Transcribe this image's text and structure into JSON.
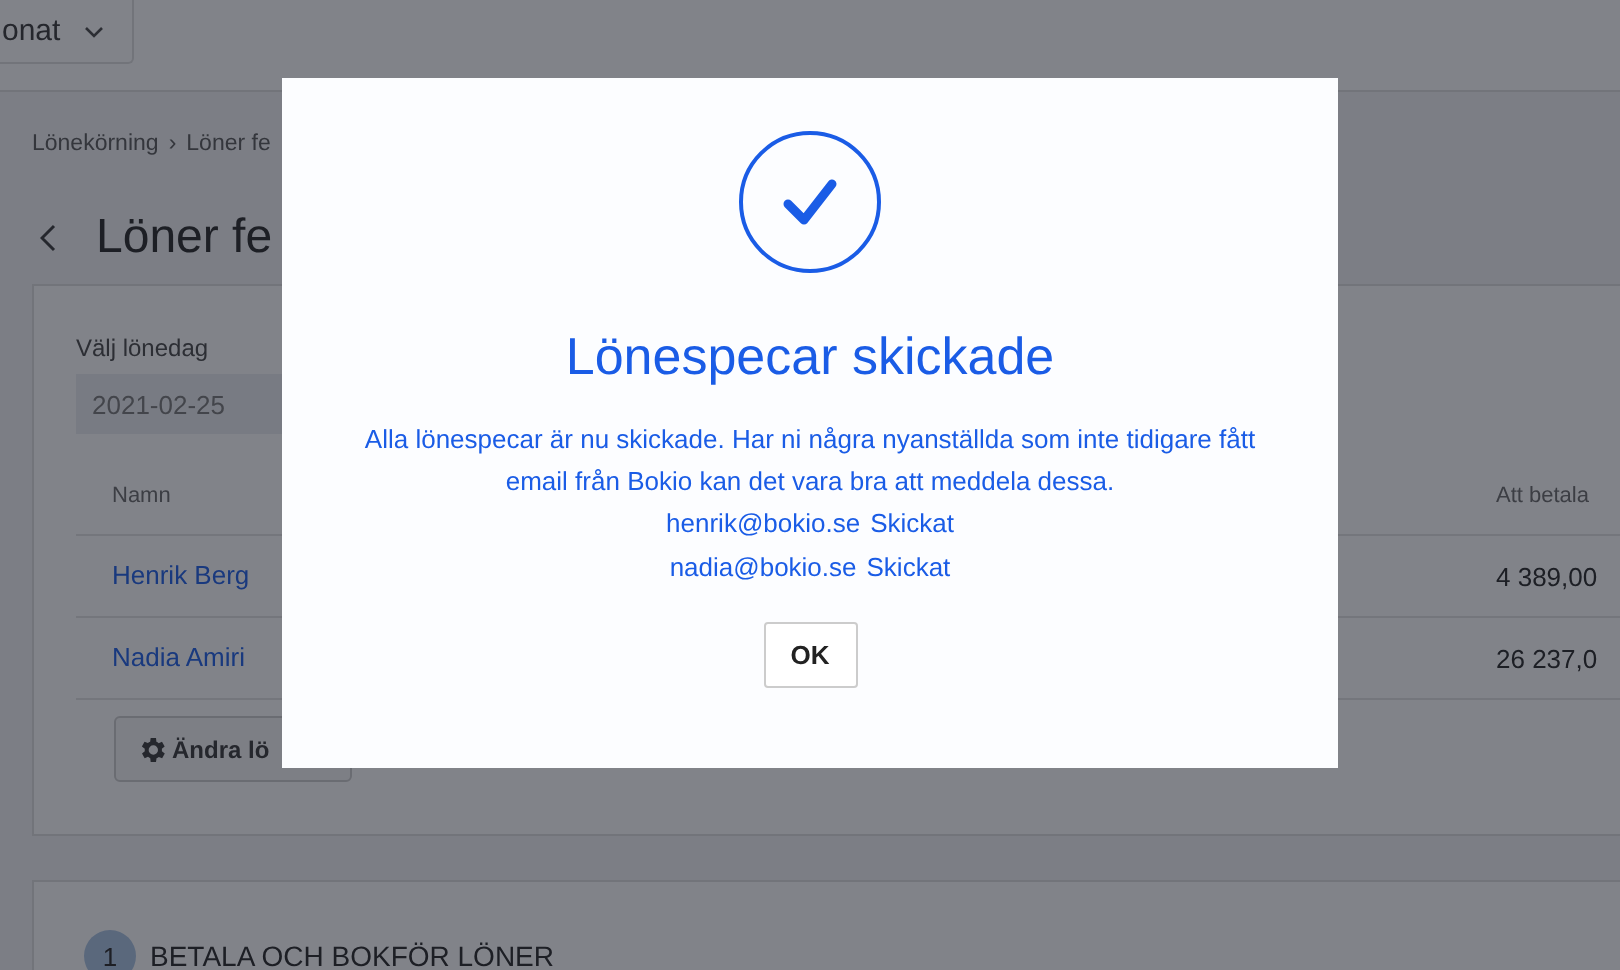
{
  "top_bar": {
    "period_dropdown": "onat"
  },
  "breadcrumb": {
    "items": [
      "Lönekörning",
      "Löner fe"
    ],
    "separator": "›"
  },
  "page_title": "Löner fe",
  "payroll_card": {
    "date_label": "Välj lönedag",
    "date_value": "2021-02-25",
    "columns": [
      "Namn",
      "Att betala"
    ],
    "rows": [
      {
        "name": "Henrik Berg",
        "amount": "4 389,00"
      },
      {
        "name": "Nadia Amiri",
        "amount": "26 237,0"
      }
    ],
    "edit_button": "Ändra lö"
  },
  "step": {
    "number": "1",
    "title": "BETALA OCH BOKFÖR LÖNER"
  },
  "dialog": {
    "title": "Lönespecar skickade",
    "message": "Alla lönespecar är nu skickade. Har ni några nyanställda som inte tidigare fått email från Bokio kan det vara bra att meddela dessa.",
    "recipients": [
      {
        "email": "henrik@bokio.se",
        "status": "Skickat"
      },
      {
        "email": "nadia@bokio.se",
        "status": "Skickat"
      }
    ],
    "button": "OK"
  }
}
